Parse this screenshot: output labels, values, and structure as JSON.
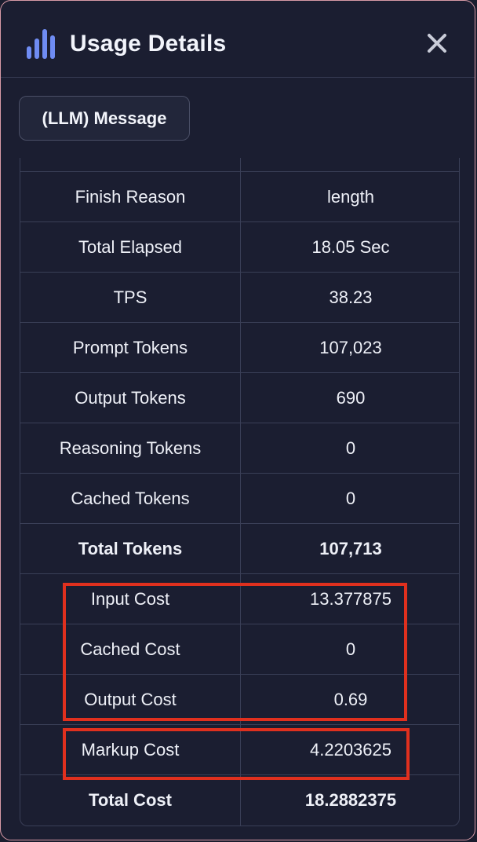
{
  "header": {
    "title": "Usage Details",
    "icon": "bar-chart-icon",
    "close_icon": "close-icon"
  },
  "tab": {
    "label": "(LLM) Message"
  },
  "table": {
    "rows": [
      {
        "label": "Finish Reason",
        "value": "length",
        "bold": false
      },
      {
        "label": "Total Elapsed",
        "value": "18.05 Sec",
        "bold": false
      },
      {
        "label": "TPS",
        "value": "38.23",
        "bold": false
      },
      {
        "label": "Prompt Tokens",
        "value": "107,023",
        "bold": false
      },
      {
        "label": "Output Tokens",
        "value": "690",
        "bold": false
      },
      {
        "label": "Reasoning Tokens",
        "value": "0",
        "bold": false
      },
      {
        "label": "Cached Tokens",
        "value": "0",
        "bold": false
      },
      {
        "label": "Total Tokens",
        "value": "107,713",
        "bold": true
      },
      {
        "label": "Input Cost",
        "value": "13.377875",
        "bold": false
      },
      {
        "label": "Cached Cost",
        "value": "0",
        "bold": false
      },
      {
        "label": "Output Cost",
        "value": "0.69",
        "bold": false
      },
      {
        "label": "Markup Cost",
        "value": "4.2203625",
        "bold": false
      },
      {
        "label": "Total Cost",
        "value": "18.2882375",
        "bold": true
      }
    ]
  },
  "colors": {
    "background": "#1b1e31",
    "border": "#3a3f57",
    "accent_icon": "#6f8cf3",
    "highlight": "#e0301e",
    "text": "#eef0f7"
  }
}
